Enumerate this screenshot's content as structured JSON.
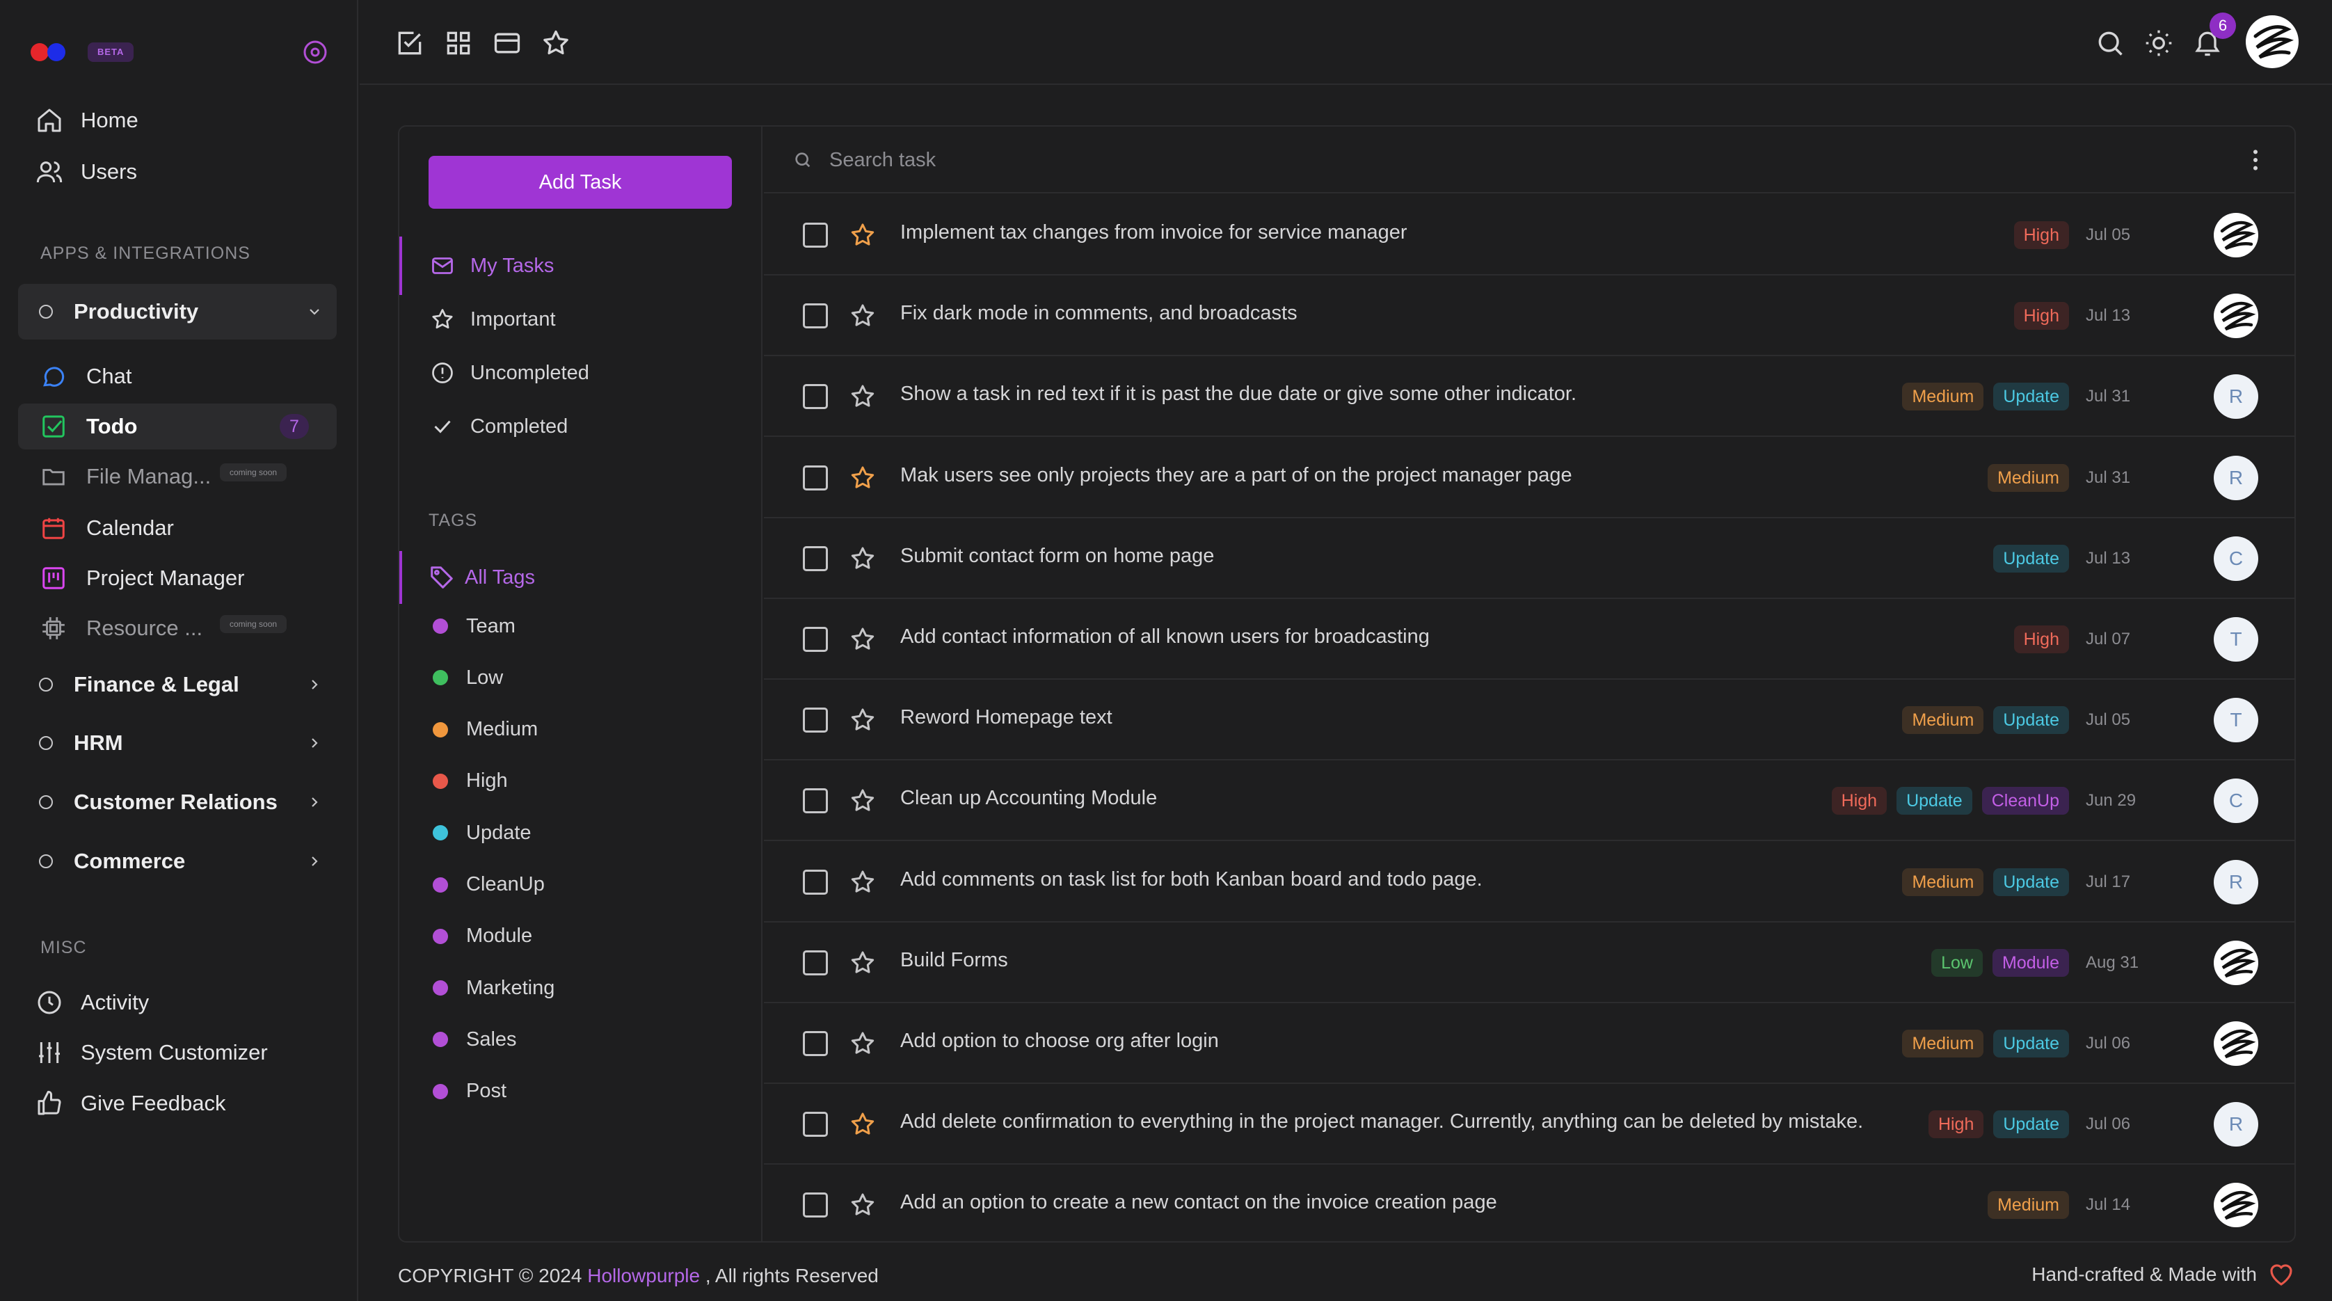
{
  "brand": {
    "beta": "BETA"
  },
  "nav": {
    "main": [
      {
        "label": "Home",
        "icon": "home-icon"
      },
      {
        "label": "Users",
        "icon": "users-icon"
      }
    ],
    "apps_title": "APPS & INTEGRATIONS",
    "groups": {
      "productivity": "Productivity",
      "finance": "Finance & Legal",
      "hrm": "HRM",
      "customer": "Customer Relations",
      "commerce": "Commerce"
    },
    "productivity_items": [
      {
        "label": "Chat",
        "icon": "chat-icon",
        "color": "#3b82f6"
      },
      {
        "label": "Todo",
        "icon": "todo-icon",
        "color": "#22c55e",
        "count": "7"
      },
      {
        "label": "File Manag...",
        "icon": "folder-icon",
        "badge": "coming soon"
      },
      {
        "label": "Calendar",
        "icon": "calendar-icon",
        "color": "#ef4444"
      },
      {
        "label": "Project Manager",
        "icon": "kanban-icon",
        "color": "#d946ef"
      },
      {
        "label": "Resource ...",
        "icon": "chip-icon",
        "badge": "coming soon"
      }
    ],
    "misc_title": "MISC",
    "misc": [
      {
        "label": "Activity",
        "icon": "clock-icon"
      },
      {
        "label": "System Customizer",
        "icon": "sliders-icon"
      },
      {
        "label": "Give Feedback",
        "icon": "thumbs-up-icon"
      }
    ]
  },
  "topbar": {
    "notifications": "6"
  },
  "filters": {
    "add_task": "Add Task",
    "items": [
      "My Tasks",
      "Important",
      "Uncompleted",
      "Completed"
    ],
    "tags_title": "TAGS",
    "all_tags": "All Tags",
    "tags": [
      {
        "label": "Team",
        "color": "#b24fd6"
      },
      {
        "label": "Low",
        "color": "#3fbf5f"
      },
      {
        "label": "Medium",
        "color": "#f0973d"
      },
      {
        "label": "High",
        "color": "#e8584a"
      },
      {
        "label": "Update",
        "color": "#3ec3db"
      },
      {
        "label": "CleanUp",
        "color": "#b24fd6"
      },
      {
        "label": "Module",
        "color": "#b24fd6"
      },
      {
        "label": "Marketing",
        "color": "#b24fd6"
      },
      {
        "label": "Sales",
        "color": "#b24fd6"
      },
      {
        "label": "Post",
        "color": "#b24fd6"
      }
    ]
  },
  "search": {
    "placeholder": "Search task"
  },
  "tasks": [
    {
      "title": "Implement tax changes from invoice for service manager",
      "tags": [
        "High"
      ],
      "date": "Jul 05",
      "starred": true,
      "avatar": "pic"
    },
    {
      "title": "Fix dark mode in comments, and broadcasts",
      "tags": [
        "High"
      ],
      "date": "Jul 13",
      "starred": false,
      "avatar": "pic"
    },
    {
      "title": "Show a task in red text if it is past the due date or give some other indicator.",
      "tags": [
        "Medium",
        "Update"
      ],
      "date": "Jul 31",
      "starred": false,
      "avatar": "R"
    },
    {
      "title": "Mak users see only projects they are a part of on the project manager page",
      "tags": [
        "Medium"
      ],
      "date": "Jul 31",
      "starred": true,
      "avatar": "R"
    },
    {
      "title": "Submit contact form on home page",
      "tags": [
        "Update"
      ],
      "date": "Jul 13",
      "starred": false,
      "avatar": "C"
    },
    {
      "title": "Add contact information of all known users for broadcasting",
      "tags": [
        "High"
      ],
      "date": "Jul 07",
      "starred": false,
      "avatar": "T"
    },
    {
      "title": "Reword Homepage text",
      "tags": [
        "Medium",
        "Update"
      ],
      "date": "Jul 05",
      "starred": false,
      "avatar": "T"
    },
    {
      "title": "Clean up Accounting Module",
      "tags": [
        "High",
        "Update",
        "CleanUp"
      ],
      "date": "Jun 29",
      "starred": false,
      "avatar": "C"
    },
    {
      "title": "Add comments on task list for both Kanban board and todo page.",
      "tags": [
        "Medium",
        "Update"
      ],
      "date": "Jul 17",
      "starred": false,
      "avatar": "R"
    },
    {
      "title": "Build Forms",
      "tags": [
        "Low",
        "Module"
      ],
      "date": "Aug 31",
      "starred": false,
      "avatar": "pic"
    },
    {
      "title": "Add option to choose org after login",
      "tags": [
        "Medium",
        "Update"
      ],
      "date": "Jul 06",
      "starred": false,
      "avatar": "pic"
    },
    {
      "title": "Add delete confirmation to everything in the project manager. Currently, anything can be deleted by mistake.",
      "tags": [
        "High",
        "Update"
      ],
      "date": "Jul 06",
      "starred": true,
      "avatar": "R"
    },
    {
      "title": "Add an option to create a new contact on the invoice creation page",
      "tags": [
        "Medium"
      ],
      "date": "Jul 14",
      "starred": false,
      "avatar": "pic"
    }
  ],
  "footer": {
    "copyright": "COPYRIGHT © 2024 ",
    "brand": "Hollowpurple",
    "rights": " , All rights Reserved",
    "made_with": "Hand-crafted & Made with"
  }
}
